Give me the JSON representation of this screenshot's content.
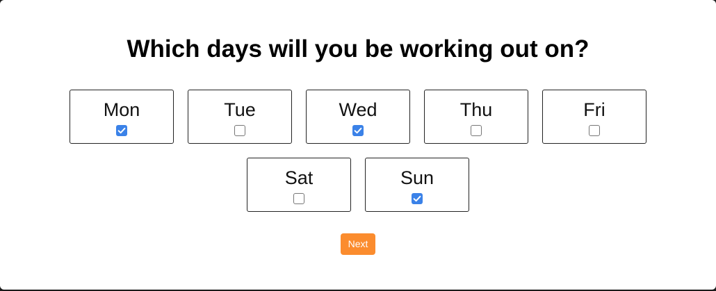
{
  "title": "Which days will you be working out on?",
  "days": [
    {
      "label": "Mon",
      "checked": true
    },
    {
      "label": "Tue",
      "checked": false
    },
    {
      "label": "Wed",
      "checked": true
    },
    {
      "label": "Thu",
      "checked": false
    },
    {
      "label": "Fri",
      "checked": false
    },
    {
      "label": "Sat",
      "checked": false
    },
    {
      "label": "Sun",
      "checked": true
    }
  ],
  "next_label": "Next",
  "colors": {
    "accent": "#3b82e8",
    "button": "#fb8c2e"
  }
}
